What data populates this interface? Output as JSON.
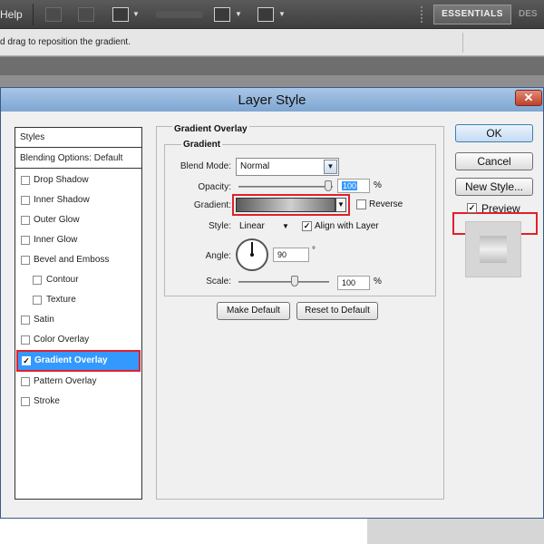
{
  "app": {
    "menu_help": "Help",
    "workspace_active": "ESSENTIALS",
    "workspace_next": "DES",
    "options_hint": "d drag to reposition the gradient."
  },
  "dialog": {
    "title": "Layer Style",
    "close_glyph": "✕",
    "styles_list": {
      "header": "Styles",
      "blending": "Blending Options: Default",
      "items": [
        {
          "label": "Drop Shadow",
          "checked": false
        },
        {
          "label": "Inner Shadow",
          "checked": false
        },
        {
          "label": "Outer Glow",
          "checked": false
        },
        {
          "label": "Inner Glow",
          "checked": false
        },
        {
          "label": "Bevel and Emboss",
          "checked": false
        },
        {
          "label": "Contour",
          "checked": false
        },
        {
          "label": "Texture",
          "checked": false
        },
        {
          "label": "Satin",
          "checked": false
        },
        {
          "label": "Color Overlay",
          "checked": false
        },
        {
          "label": "Gradient Overlay",
          "checked": true,
          "selected": true
        },
        {
          "label": "Pattern Overlay",
          "checked": false
        },
        {
          "label": "Stroke",
          "checked": false
        }
      ]
    },
    "gradient_overlay": {
      "section_title": "Gradient Overlay",
      "group_title": "Gradient",
      "blend_mode_label": "Blend Mode:",
      "blend_mode_value": "Normal",
      "opacity_label": "Opacity:",
      "opacity_value": "100",
      "opacity_unit": "%",
      "gradient_label": "Gradient:",
      "reverse_label": "Reverse",
      "reverse_checked": false,
      "style_label": "Style:",
      "style_value": "Linear",
      "align_label": "Align with Layer",
      "align_checked": true,
      "angle_label": "Angle:",
      "angle_value": "90",
      "angle_unit": "°",
      "scale_label": "Scale:",
      "scale_value": "100",
      "scale_unit": "%",
      "make_default": "Make Default",
      "reset_default": "Reset to Default"
    },
    "buttons": {
      "ok": "OK",
      "cancel": "Cancel",
      "new_style": "New Style...",
      "preview_label": "Preview",
      "preview_checked": true
    }
  },
  "colors": {
    "highlight": "#e0202a",
    "selection": "#3399ff",
    "titlebar": "#8fb3da"
  }
}
